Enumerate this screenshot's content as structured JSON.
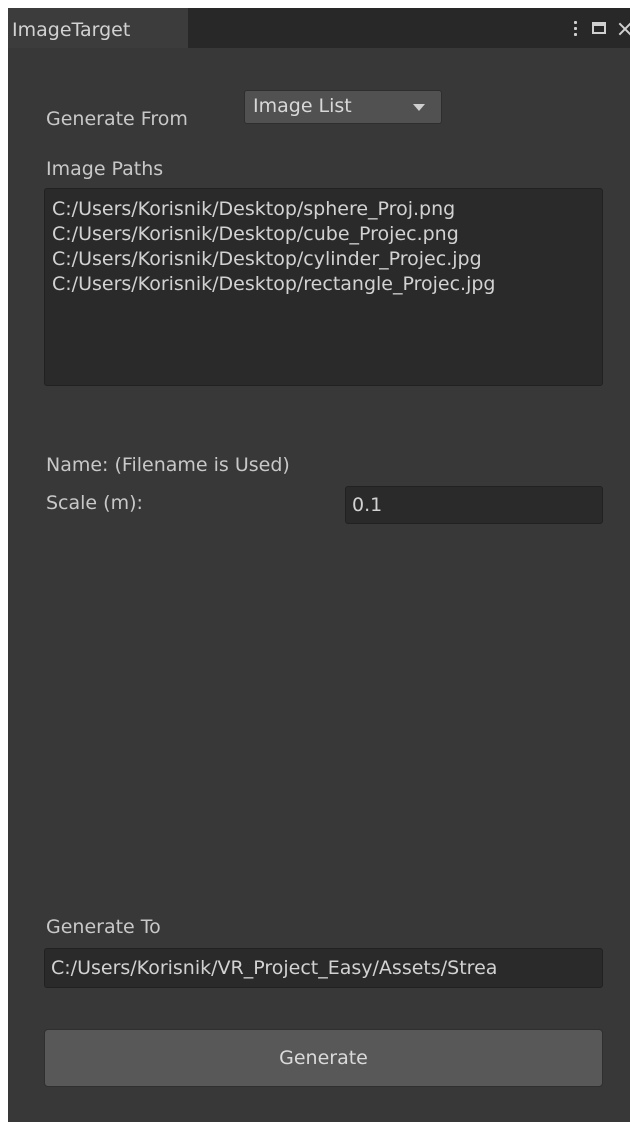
{
  "window": {
    "tab_title": "ImageTarget"
  },
  "form": {
    "generate_from_label": "Generate From",
    "generate_from_value": "Image List",
    "image_paths_label": "Image Paths",
    "image_paths": [
      "C:/Users/Korisnik/Desktop/sphere_Proj.png",
      "C:/Users/Korisnik/Desktop/cube_Projec.png",
      "C:/Users/Korisnik/Desktop/cylinder_Projec.jpg",
      "C:/Users/Korisnik/Desktop/rectangle_Projec.jpg"
    ],
    "name_label": "Name: (Filename is Used)",
    "scale_label": "Scale (m):",
    "scale_value": "0.1",
    "generate_to_label": "Generate To",
    "generate_to_value": "C:/Users/Korisnik/VR_Project_Easy/Assets/Strea",
    "generate_button_label": "Generate"
  },
  "icons": {
    "menu": "kebab-menu-icon",
    "maximize": "maximize-icon",
    "close": "close-icon",
    "dropdown": "chevron-down-icon"
  },
  "colors": {
    "panel_bg": "#383838",
    "tabbar_bg": "#282828",
    "field_bg": "#2a2a2a",
    "button_bg": "#585858",
    "text": "#c8c8c8"
  }
}
